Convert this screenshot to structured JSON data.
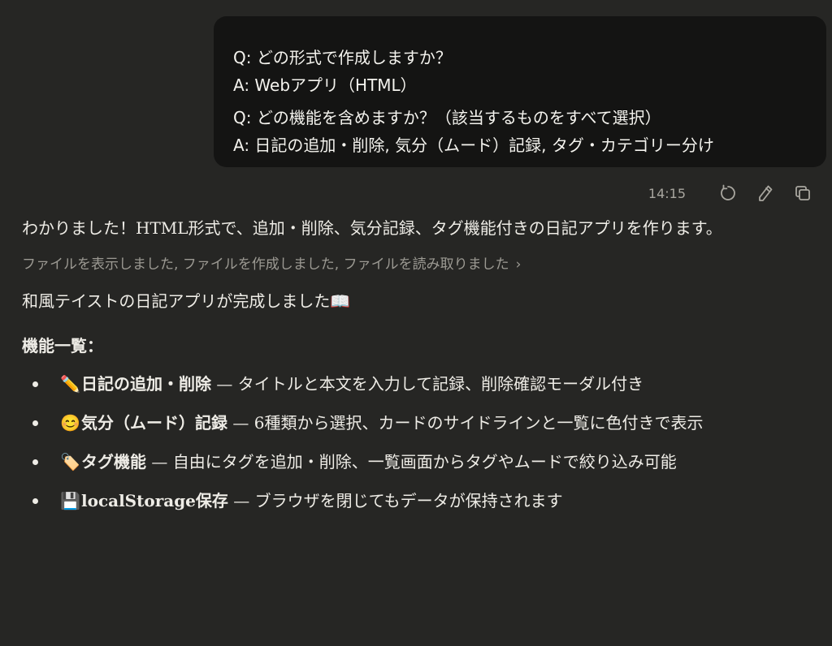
{
  "user_message": {
    "lines": [
      "Q: どの形式で作成しますか？",
      "A: Webアプリ（HTML）",
      "Q: どの機能を含めますか？（該当するものをすべて選択）",
      "A: 日記の追加・削除, 気分（ムード）記録, タグ・カテゴリー分け"
    ],
    "timestamp": "14:15",
    "actions": [
      "retry-icon",
      "edit-icon",
      "copy-icon"
    ]
  },
  "assistant": {
    "intro": "わかりました！HTML形式で、追加・削除、気分記録、タグ機能付きの日記アプリを作ります。",
    "activity": "ファイルを表示しました, ファイルを作成しました, ファイルを読み取りました",
    "activity_chevron": "›",
    "done": "和風テイストの日記アプリが完成しました📖",
    "features_heading": "機能一覧：",
    "features": [
      {
        "emoji": "✏️",
        "title": "日記の追加・削除",
        "desc": " — タイトルと本文を入力して記録、削除確認モーダル付き"
      },
      {
        "emoji": "😊",
        "title": "気分（ムード）記録",
        "desc": " — 6種類から選択、カードのサイドラインと一覧に色付きで表示"
      },
      {
        "emoji": "🏷️",
        "title": "タグ機能",
        "desc": " — 自由にタグを追加・削除、一覧画面からタグやムードで絞り込み可能"
      },
      {
        "emoji": "💾",
        "title": "localStorage保存",
        "desc": " — ブラウザを閉じてもデータが保持されます"
      }
    ]
  },
  "colors": {
    "background": "#262624",
    "user_bubble": "#141413",
    "text": "#eeece6",
    "muted": "#9c9a93"
  }
}
